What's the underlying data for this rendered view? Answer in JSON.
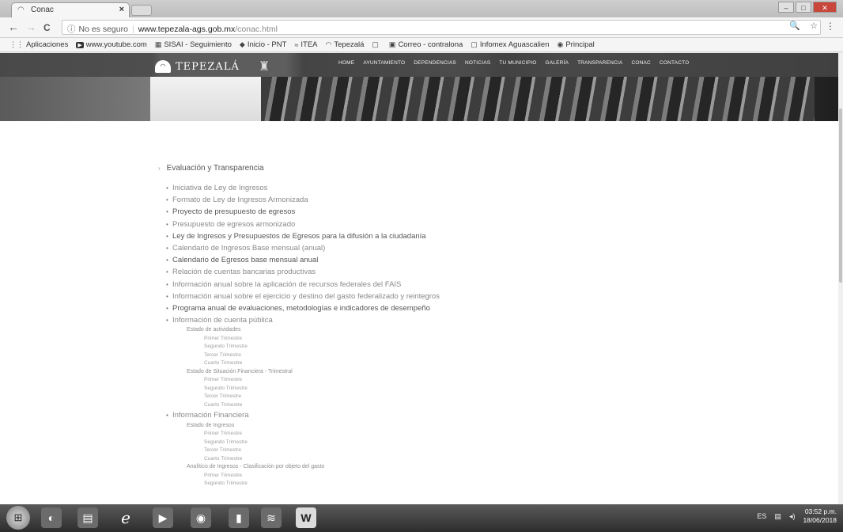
{
  "browser": {
    "tab_title": "Conac",
    "tab_close": "×",
    "nav": {
      "back": "←",
      "forward": "→",
      "reload": "C"
    },
    "omnibox": {
      "security": "No es seguro",
      "host": "www.tepezala-ags.gob.mx",
      "path": "/conac.html"
    },
    "zoom_icon": "🔍",
    "star_icon": "☆",
    "menu_icon": "⋮",
    "window_controls": {
      "minimize": "–",
      "maximize": "□",
      "close": "✕"
    }
  },
  "bookmarks": [
    {
      "icon": "apps-icon",
      "glyph": "⋮⋮",
      "label": "Aplicaciones"
    },
    {
      "icon": "youtube-icon",
      "glyph": "▶",
      "label": "www.youtube.com"
    },
    {
      "icon": "page-icon",
      "glyph": "▦",
      "label": "SISAI - Seguimiento"
    },
    {
      "icon": "pnt-icon",
      "glyph": "◆",
      "label": "Inicio - PNT"
    },
    {
      "icon": "itea-icon",
      "glyph": "≈",
      "label": "ITEA"
    },
    {
      "icon": "tepezala-icon",
      "glyph": "◠",
      "label": "Tepezalá"
    },
    {
      "icon": "doc-icon",
      "glyph": "▢",
      "label": ""
    },
    {
      "icon": "mail-icon",
      "glyph": "▣",
      "label": "Correo - contralona"
    },
    {
      "icon": "doc-icon",
      "glyph": "▢",
      "label": "Infomex Aguascalien"
    },
    {
      "icon": "globe-icon",
      "glyph": "◉",
      "label": "Principal"
    }
  ],
  "site": {
    "logo_text": "TEPEZALÁ",
    "nav": [
      "HOME",
      "AYUNTAMIENTO",
      "DEPENDENCIAS",
      "NOTICIAS",
      "TU MUNICIPIO",
      "GALERÍA",
      "TRANSPARENCIA",
      "CONAC",
      "CONTACTO"
    ]
  },
  "content": {
    "section_title": "Evaluación y Transparencia",
    "items": [
      {
        "label": "Iniciativa de Ley de Ingresos",
        "faint": true
      },
      {
        "label": "Formato de Ley de Ingresos Armonizada",
        "faint": true
      },
      {
        "label": "Proyecto de presupuesto de egresos",
        "faint": false
      },
      {
        "label": "Presupuesto de egresos armonizado",
        "faint": true
      },
      {
        "label": "Ley de Ingresos y Presupuestos de Egresos para la difusión a la ciudadanía",
        "faint": false
      },
      {
        "label": "Calendario de Ingresos Base mensual (anual)",
        "faint": true
      },
      {
        "label": "Calendario de Egresos base mensual anual",
        "faint": false
      },
      {
        "label": "Relación de cuentas bancarias productivas",
        "faint": true
      },
      {
        "label": "Información anual sobre la aplicación de recursos federales del FAIS",
        "faint": true
      },
      {
        "label": "Información anual sobre el ejercicio y destino del gasto federalizado y reintegros",
        "faint": true
      },
      {
        "label": "Programa anual de evaluaciones, metodologías e indicadores de desempeño",
        "faint": false
      },
      {
        "label": "Información de cuenta pública",
        "faint": true,
        "groups": [
          {
            "label": "Estado de actividades",
            "quarters": [
              "Primer Trimestre",
              "Segundo Trimestre",
              "Tercer Trimestre",
              "Cuarto Trimestre"
            ]
          },
          {
            "label": "Estado de Situación Financiera - Trimestral",
            "quarters": [
              "Primer Trimestre",
              "Segundo Trimestre",
              "Tercer Trimestre",
              "Cuarto Trimestre"
            ]
          }
        ]
      },
      {
        "label": "Información Financiera",
        "faint": true,
        "groups": [
          {
            "label": "Estado de Ingresos",
            "quarters": [
              "Primer Trimestre",
              "Segundo Trimestre",
              "Tercer Trimestre",
              "Cuarto Trimestre"
            ]
          },
          {
            "label": "Analítico de Ingresos - Clasificación por objeto del gasto",
            "quarters": [
              "Primer Trimestre",
              "Segundo Trimestre"
            ]
          }
        ]
      }
    ]
  },
  "taskbar": {
    "apps": [
      "explorer-icon",
      "chrome-icon",
      "files-icon",
      "ie-icon",
      "media-icon",
      "app-icon",
      "doc-icon",
      "spotify-icon",
      "word-icon"
    ],
    "glyphs": [
      "◐",
      "▤",
      "e",
      "▶",
      "◉",
      "▮",
      "≋",
      "W"
    ],
    "lang": "ES",
    "time": "03:52 p.m.",
    "date": "18/06/2018"
  }
}
